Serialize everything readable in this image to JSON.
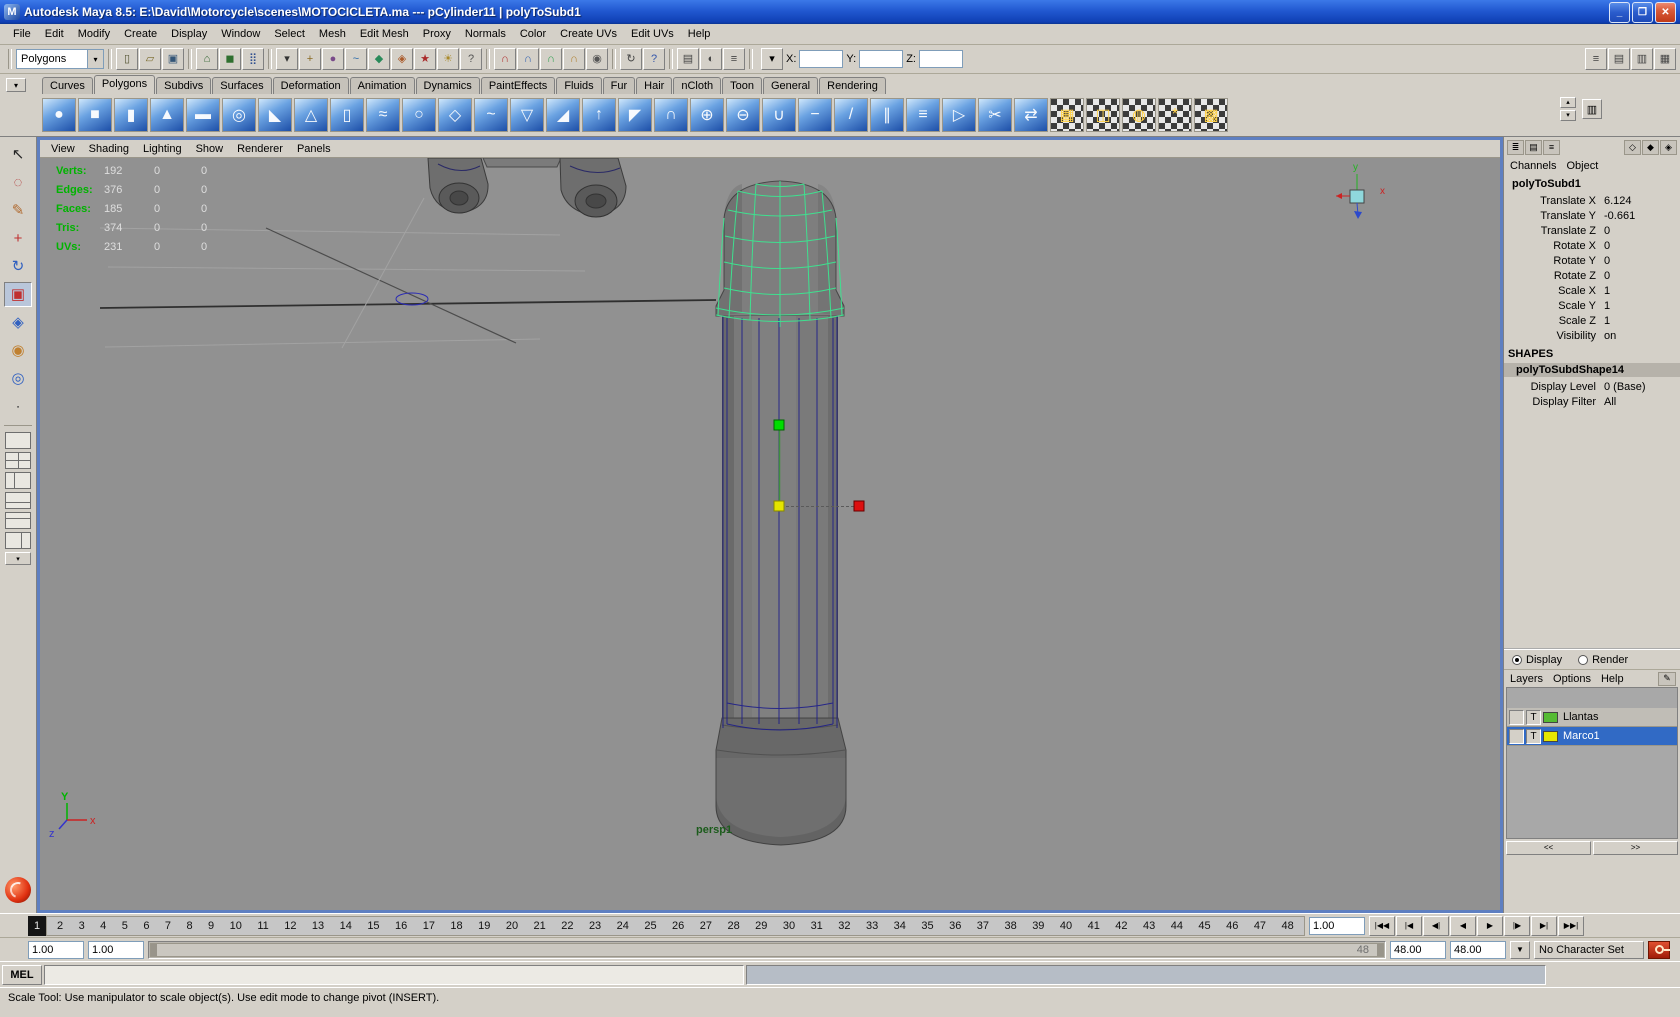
{
  "window": {
    "app_icon": "M",
    "title": "Autodesk Maya 8.5: E:\\David\\Motorcycle\\scenes\\MOTOCICLETA.ma   ---   pCylinder11 | polyToSubd1",
    "minimize": "_",
    "maximize": "❐",
    "close": "✕"
  },
  "colors": {
    "titlebar_blue": "#2158d0",
    "selection_blue": "#316ac5",
    "viewport_gray": "#919191",
    "hud_green": "#00b400",
    "selected_wireframe_green": "#3fe08f",
    "subdiv_cage_navy": "#1e1e8a",
    "manip_x_red": "#dd1010",
    "manip_y_green": "#00dd00",
    "manip_center_yellow": "#e4e400",
    "autokey_red": "#c03a18"
  },
  "menu_bar": {
    "items": [
      "File",
      "Edit",
      "Modify",
      "Create",
      "Display",
      "Window",
      "Select",
      "Mesh",
      "Edit Mesh",
      "Proxy",
      "Normals",
      "Color",
      "Create UVs",
      "Edit UVs",
      "Help"
    ]
  },
  "status_line": {
    "mode_selector": "Polygons",
    "dropdown_arrow": "▾",
    "file_icons": [
      {
        "name": "new-scene-icon",
        "glyph": "▯",
        "color": "#555533"
      },
      {
        "name": "open-scene-icon",
        "glyph": "▱",
        "color": "#7a6a2a"
      },
      {
        "name": "save-scene-icon",
        "glyph": "▣",
        "color": "#335577"
      }
    ],
    "select_mode_icons": [
      {
        "name": "select-by-hierarchy-icon",
        "glyph": "⌂",
        "color": "#336633"
      },
      {
        "name": "select-by-object-icon",
        "glyph": "◼",
        "color": "#2f6f2f"
      },
      {
        "name": "select-by-component-icon",
        "glyph": "⣿",
        "color": "#2f4f8f"
      }
    ],
    "mask_icons": [
      {
        "name": "set-selection-mask-dropdown-icon",
        "glyph": "▾",
        "color": "#333333"
      },
      {
        "name": "select-handles-mask-icon",
        "glyph": "+",
        "color": "#8a6a22"
      },
      {
        "name": "select-joints-mask-icon",
        "glyph": "●",
        "color": "#7a4a8a"
      },
      {
        "name": "select-curves-mask-icon",
        "glyph": "~",
        "color": "#2a6aaa"
      },
      {
        "name": "select-surfaces-mask-icon",
        "glyph": "◆",
        "color": "#2a8a5a"
      },
      {
        "name": "select-deformations-mask-icon",
        "glyph": "◈",
        "color": "#aa5a2a"
      },
      {
        "name": "select-dynamics-mask-icon",
        "glyph": "★",
        "color": "#aa2a2a"
      },
      {
        "name": "select-rendering-mask-icon",
        "glyph": "☀",
        "color": "#aa8a2a"
      },
      {
        "name": "select-misc-mask-icon",
        "glyph": "?",
        "color": "#555555"
      }
    ],
    "snap_icons": [
      {
        "name": "snap-to-grids-icon",
        "glyph": "∩",
        "color": "#b03030"
      },
      {
        "name": "snap-to-curves-icon",
        "glyph": "∩",
        "color": "#3060b0"
      },
      {
        "name": "snap-to-points-icon",
        "glyph": "∩",
        "color": "#30a050"
      },
      {
        "name": "snap-to-view-planes-icon",
        "glyph": "∩",
        "color": "#b08030"
      },
      {
        "name": "make-live-icon",
        "glyph": "◉",
        "color": "#555555"
      }
    ],
    "history_icons": [
      {
        "name": "construction-history-toggle-icon",
        "glyph": "↻",
        "color": "#444444"
      },
      {
        "name": "help-icon",
        "glyph": "?",
        "color": "#3355aa"
      }
    ],
    "render_icons": [
      {
        "name": "render-current-frame-icon",
        "glyph": "▤",
        "color": "#444444"
      },
      {
        "name": "ipr-render-icon",
        "glyph": "◐",
        "color": "#444444"
      },
      {
        "name": "render-globals-icon",
        "glyph": "≡",
        "color": "#444444"
      }
    ],
    "input_selector_glyph": "▾",
    "x_label": "X:",
    "y_label": "Y:",
    "z_label": "Z:",
    "x_value": "",
    "y_value": "",
    "z_value": "",
    "right_icons": [
      {
        "name": "show-hide-ui-elements-icon",
        "glyph": "≡",
        "color": "#444444"
      },
      {
        "name": "attribute-editor-toggle-icon",
        "glyph": "▤",
        "color": "#444444"
      },
      {
        "name": "tool-settings-toggle-icon",
        "glyph": "▥",
        "color": "#444444"
      },
      {
        "name": "channel-box-toggle-icon",
        "glyph": "▦",
        "color": "#444444"
      }
    ]
  },
  "shelf": {
    "tabs": [
      {
        "label": "Curves"
      },
      {
        "label": "Polygons",
        "active": true
      },
      {
        "label": "Subdivs"
      },
      {
        "label": "Surfaces"
      },
      {
        "label": "Deformation"
      },
      {
        "label": "Animation"
      },
      {
        "label": "Dynamics"
      },
      {
        "label": "PaintEffects"
      },
      {
        "label": "Fluids"
      },
      {
        "label": "Fur"
      },
      {
        "label": "Hair"
      },
      {
        "label": "nCloth"
      },
      {
        "label": "Toon"
      },
      {
        "label": "General"
      },
      {
        "label": "Rendering"
      }
    ],
    "icons": [
      {
        "name": "poly-sphere-icon",
        "glyph": "●"
      },
      {
        "name": "poly-cube-icon",
        "glyph": "■"
      },
      {
        "name": "poly-cylinder-icon",
        "glyph": "▮"
      },
      {
        "name": "poly-cone-icon",
        "glyph": "▲"
      },
      {
        "name": "poly-plane-icon",
        "glyph": "▬"
      },
      {
        "name": "poly-torus-icon",
        "glyph": "◎"
      },
      {
        "name": "poly-prism-icon",
        "glyph": "◣"
      },
      {
        "name": "poly-pyramid-icon",
        "glyph": "△"
      },
      {
        "name": "poly-pipe-icon",
        "glyph": "▯"
      },
      {
        "name": "poly-helix-icon",
        "glyph": "≈"
      },
      {
        "name": "poly-soccer-ball-icon",
        "glyph": "○"
      },
      {
        "name": "poly-platonic-solid-icon",
        "glyph": "◇"
      },
      {
        "name": "smooth-icon",
        "glyph": "~"
      },
      {
        "name": "poly-reduce-icon",
        "glyph": "▽"
      },
      {
        "name": "poly-wedge-icon",
        "glyph": "◢"
      },
      {
        "name": "poly-extrude-icon",
        "glyph": "↑"
      },
      {
        "name": "poly-bevel-icon",
        "glyph": "◤"
      },
      {
        "name": "poly-bridge-icon",
        "glyph": "∩"
      },
      {
        "name": "poly-combine-icon",
        "glyph": "⊕"
      },
      {
        "name": "poly-separate-icon",
        "glyph": "⊖"
      },
      {
        "name": "boolean-union-icon",
        "glyph": "∪"
      },
      {
        "name": "boolean-difference-icon",
        "glyph": "−"
      },
      {
        "name": "split-polygon-tool-icon",
        "glyph": "/"
      },
      {
        "name": "insert-edge-loop-tool-icon",
        "glyph": "∥"
      },
      {
        "name": "offset-edge-loop-tool-icon",
        "glyph": "≡"
      },
      {
        "name": "append-to-polygon-tool-icon",
        "glyph": "▷"
      },
      {
        "name": "cut-faces-tool-icon",
        "glyph": "✂"
      },
      {
        "name": "mirror-geometry-icon",
        "glyph": "⇄"
      },
      {
        "name": "planar-mapping-icon",
        "glyph": "▦",
        "kind": "uv"
      },
      {
        "name": "cylindrical-mapping-icon",
        "glyph": "◫",
        "kind": "uv"
      },
      {
        "name": "spherical-mapping-icon",
        "glyph": "◍",
        "kind": "uv"
      },
      {
        "name": "automatic-mapping-icon",
        "glyph": "*",
        "kind": "uv"
      },
      {
        "name": "uv-texture-editor-icon",
        "glyph": "▩",
        "kind": "uv"
      }
    ]
  },
  "toolbox": {
    "tools": [
      {
        "name": "select-tool",
        "glyph": "↖",
        "color": "#222222"
      },
      {
        "name": "lasso-select-tool",
        "glyph": "◌",
        "color": "#b03030"
      },
      {
        "name": "paint-select-tool",
        "glyph": "✎",
        "color": "#b06a30"
      },
      {
        "name": "move-tool",
        "glyph": "+",
        "color": "#c03030"
      },
      {
        "name": "rotate-tool",
        "glyph": "↻",
        "color": "#3060c0"
      },
      {
        "name": "scale-tool",
        "glyph": "▣",
        "color": "#c03030",
        "active": true
      },
      {
        "name": "universal-manipulator-tool",
        "glyph": "◈",
        "color": "#3060c0"
      },
      {
        "name": "soft-modification-tool",
        "glyph": "◉",
        "color": "#c08030"
      },
      {
        "name": "show-manipulator-tool",
        "glyph": "◎",
        "color": "#3060c0"
      },
      {
        "name": "last-tool-used",
        "glyph": "∙",
        "color": "#444444"
      }
    ],
    "layouts": [
      {
        "name": "single-perspective-layout-button",
        "cls": "lay-1"
      },
      {
        "name": "four-view-layout-button",
        "cls": "lay-4"
      },
      {
        "name": "persp-outliner-layout-button",
        "cls": "lay-r"
      },
      {
        "name": "persp-graph-layout-button",
        "cls": "lay-b"
      },
      {
        "name": "hypershade-persp-layout-button",
        "cls": "lay-t"
      },
      {
        "name": "persp-relationship-layout-button",
        "cls": "lay-l"
      }
    ],
    "scroll_glyph": "▾"
  },
  "viewport": {
    "panel_menus": [
      "View",
      "Shading",
      "Lighting",
      "Show",
      "Renderer",
      "Panels"
    ],
    "hud_rows": [
      {
        "label": "Verts:",
        "v1": "192",
        "v2": "0",
        "v3": "0"
      },
      {
        "label": "Edges:",
        "v1": "376",
        "v2": "0",
        "v3": "0"
      },
      {
        "label": "Faces:",
        "v1": "185",
        "v2": "0",
        "v3": "0"
      },
      {
        "label": "Tris:",
        "v1": "374",
        "v2": "0",
        "v3": "0"
      },
      {
        "label": "UVs:",
        "v1": "231",
        "v2": "0",
        "v3": "0"
      }
    ],
    "camera_label": "persp1",
    "axis_triad": {
      "y": "Y",
      "z": "z",
      "x": "x"
    },
    "compass": {
      "y": "y",
      "x": "x"
    }
  },
  "channel_box": {
    "toolbar_left": [
      {
        "name": "channel-manipulator-mode-icon",
        "glyph": "≣"
      },
      {
        "name": "channel-speed-mode-icon",
        "glyph": "▤"
      },
      {
        "name": "channel-list-mode-icon",
        "glyph": "≡"
      }
    ],
    "toolbar_right": [
      {
        "name": "manip-default-icon",
        "glyph": "◇"
      },
      {
        "name": "manip-no-visual-icon",
        "glyph": "◆"
      },
      {
        "name": "manip-standard-icon",
        "glyph": "◈"
      }
    ],
    "menus": [
      "Channels",
      "Object"
    ],
    "node_name": "polyToSubd1",
    "attributes": [
      {
        "name": "Translate X",
        "value": "6.124"
      },
      {
        "name": "Translate Y",
        "value": "-0.661"
      },
      {
        "name": "Translate Z",
        "value": "0"
      },
      {
        "name": "Rotate X",
        "value": "0"
      },
      {
        "name": "Rotate Y",
        "value": "0"
      },
      {
        "name": "Rotate Z",
        "value": "0"
      },
      {
        "name": "Scale X",
        "value": "1"
      },
      {
        "name": "Scale Y",
        "value": "1"
      },
      {
        "name": "Scale Z",
        "value": "1"
      },
      {
        "name": "Visibility",
        "value": "on"
      }
    ],
    "shapes_header": "SHAPES",
    "shape_name": "polyToSubdShape14",
    "shape_attributes": [
      {
        "name": "Display Level",
        "value": "0 (Base)"
      },
      {
        "name": "Display Filter",
        "value": "All"
      }
    ]
  },
  "layer_editor": {
    "radio_display": "Display",
    "radio_render": "Render",
    "menus": [
      "Layers",
      "Options",
      "Help"
    ],
    "layers": [
      {
        "name": "Llantas",
        "t": "T",
        "color": "#55bb33",
        "selected": false
      },
      {
        "name": "Marco1",
        "t": "T",
        "color": "#e6e600",
        "selected": true
      }
    ],
    "pager_prev": "<<",
    "pager_next": ">>"
  },
  "time_slider": {
    "current_frame": "1",
    "current_time": "1.00",
    "frames": [
      "2",
      "3",
      "4",
      "5",
      "6",
      "7",
      "8",
      "9",
      "10",
      "11",
      "12",
      "13",
      "14",
      "15",
      "16",
      "17",
      "18",
      "19",
      "20",
      "21",
      "22",
      "23",
      "24",
      "25",
      "26",
      "27",
      "28",
      "29",
      "30",
      "31",
      "32",
      "33",
      "34",
      "35",
      "36",
      "37",
      "38",
      "39",
      "40",
      "41",
      "42",
      "43",
      "44",
      "45",
      "46",
      "47",
      "48"
    ],
    "playback_buttons": [
      {
        "name": "go-to-start-button",
        "glyph": "|◀◀"
      },
      {
        "name": "step-back-frame-button",
        "glyph": "|◀"
      },
      {
        "name": "step-back-key-button",
        "glyph": "◀|"
      },
      {
        "name": "play-backwards-button",
        "glyph": "◀"
      },
      {
        "name": "play-forwards-button",
        "glyph": "▶"
      },
      {
        "name": "step-forward-key-button",
        "glyph": "|▶"
      },
      {
        "name": "step-forward-frame-button",
        "glyph": "▶|"
      },
      {
        "name": "go-to-end-button",
        "glyph": "▶▶|"
      }
    ]
  },
  "range_slider": {
    "anim_start": "1.00",
    "playback_start": "1.00",
    "range_end_inline": "48",
    "playback_end": "48.00",
    "anim_end": "48.00",
    "dropdown_glyph": "▼",
    "character_set": "No Character Set"
  },
  "command_line": {
    "label": "MEL",
    "input_value": ""
  },
  "help_line": {
    "text": "Scale Tool: Use manipulator to scale object(s). Use edit mode to change pivot (INSERT)."
  }
}
